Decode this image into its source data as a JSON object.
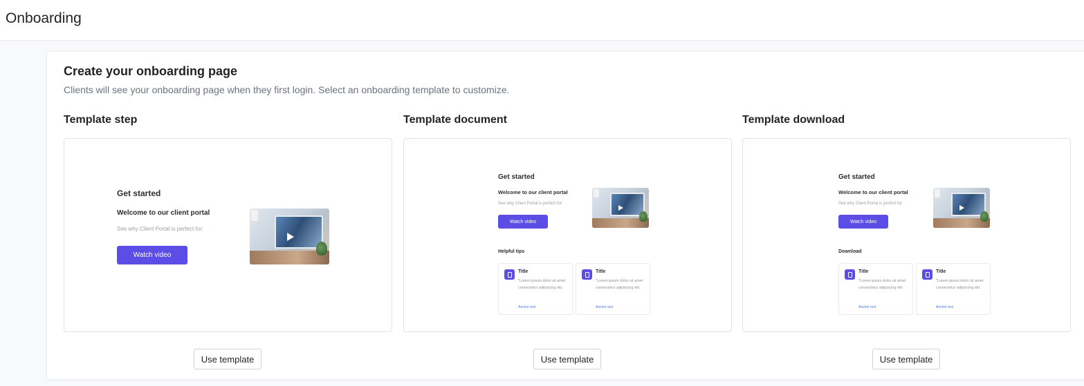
{
  "header": {
    "title": "Onboarding"
  },
  "card": {
    "title": "Create your onboarding page",
    "subtitle": "Clients will see your onboarding page when they first login. Select an onboarding template to customize."
  },
  "preview_text": {
    "get_started": "Get started",
    "welcome": "Welcome to our client portal",
    "see_why": "See why Client Portal is perfect for:",
    "watch_video": "Watch video",
    "tip_title": "Title",
    "tip_body": "\"Lorem ipsum dolor sit amet consectetur adipiscing elit.",
    "tip_anchor": "Anchor text"
  },
  "templates": [
    {
      "title": "Template step",
      "button": "Use template"
    },
    {
      "title": "Template document",
      "section": "Helpful tips",
      "button": "Use template"
    },
    {
      "title": "Template download",
      "section": "Download",
      "button": "Use template"
    }
  ],
  "colors": {
    "accent": "#5b4de6",
    "link": "#4a7cd9"
  }
}
